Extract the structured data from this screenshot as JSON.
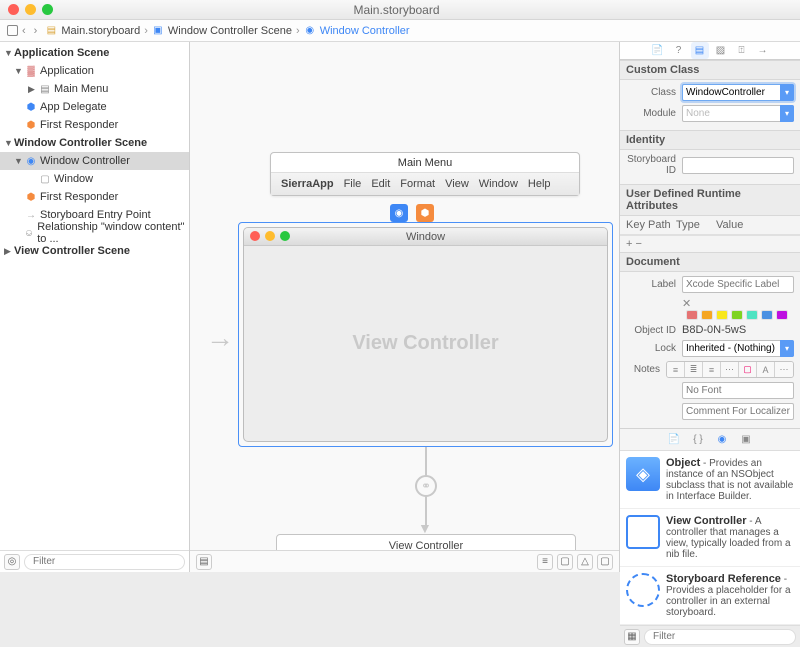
{
  "titlebar": {
    "title": "Main.storyboard"
  },
  "breadcrumb": {
    "file": "Main.storyboard",
    "scene": "Window Controller Scene",
    "item": "Window Controller"
  },
  "outline": {
    "filter_placeholder": "Filter",
    "scenes": [
      {
        "label": "Application Scene",
        "children": [
          {
            "label": "Application",
            "icon": "app",
            "children": [
              {
                "label": "Main Menu",
                "icon": "menu"
              }
            ]
          },
          {
            "label": "App Delegate",
            "icon": "cube-blue"
          },
          {
            "label": "First Responder",
            "icon": "cube-orange"
          }
        ]
      },
      {
        "label": "Window Controller Scene",
        "children": [
          {
            "label": "Window Controller",
            "icon": "wc",
            "selected": true,
            "children": [
              {
                "label": "Window",
                "icon": "win"
              }
            ]
          },
          {
            "label": "First Responder",
            "icon": "cube-orange"
          },
          {
            "label": "Storyboard Entry Point",
            "icon": "entry"
          },
          {
            "label": "Relationship \"window content\" to ...",
            "icon": "rel"
          }
        ]
      },
      {
        "label": "View Controller Scene"
      }
    ]
  },
  "canvas": {
    "menu": {
      "title": "Main Menu",
      "items": [
        "SierraApp",
        "File",
        "Edit",
        "Format",
        "View",
        "Window",
        "Help"
      ]
    },
    "window": {
      "title": "Window",
      "placeholder": "View Controller"
    },
    "vc_box": "View Controller"
  },
  "inspector": {
    "custom_class": {
      "header": "Custom Class",
      "class_label": "Class",
      "class_value": "WindowController",
      "module_label": "Module",
      "module_value": "None"
    },
    "identity": {
      "header": "Identity",
      "sid_label": "Storyboard ID",
      "sid_value": ""
    },
    "udra": {
      "header": "User Defined Runtime Attributes",
      "cols": [
        "Key Path",
        "Type",
        "Value"
      ]
    },
    "document": {
      "header": "Document",
      "label_label": "Label",
      "label_placeholder": "Xcode Specific Label",
      "objid_label": "Object ID",
      "objid_value": "B8D-0N-5wS",
      "lock_label": "Lock",
      "lock_value": "Inherited - (Nothing)",
      "notes_label": "Notes",
      "font_placeholder": "No Font",
      "comment_placeholder": "Comment For Localizer",
      "swatch_colors": [
        "#e57373",
        "#f5a623",
        "#f8e71c",
        "#7ed321",
        "#50e3c2",
        "#4a90e2",
        "#bd10e0"
      ]
    },
    "library": {
      "filter_placeholder": "Filter",
      "items": [
        {
          "name": "Object",
          "desc": "Provides an instance of an NSObject subclass that is not available in Interface Builder.",
          "icon": "cube"
        },
        {
          "name": "View Controller",
          "desc": "A controller that manages a view, typically loaded from a nib file.",
          "icon": "sq"
        },
        {
          "name": "Storyboard Reference",
          "desc": "Provides a placeholder for a controller in an external storyboard.",
          "icon": "dash"
        }
      ]
    }
  }
}
